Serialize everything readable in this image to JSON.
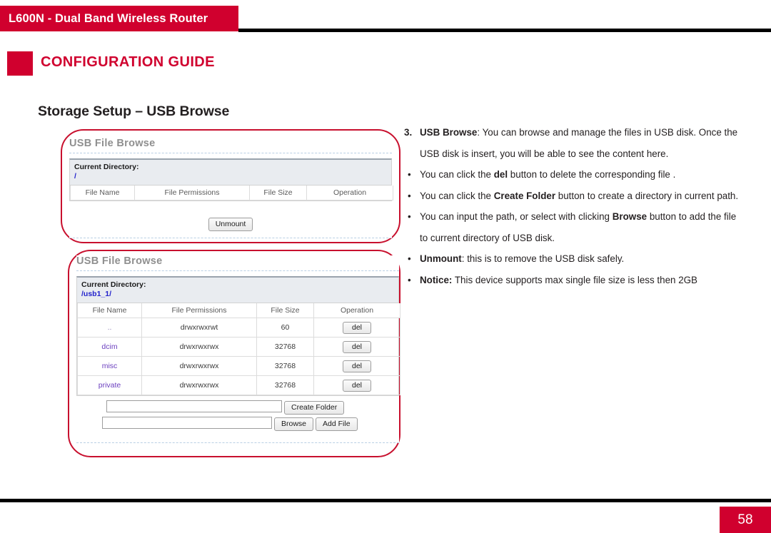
{
  "header": {
    "product_title": "L600N - Dual Band Wireless Router",
    "section_title": "CONFIGURATION GUIDE",
    "accent_color": "#D0002E"
  },
  "page": {
    "subtitle": "Storage Setup – USB Browse",
    "number": "58"
  },
  "screenshot_empty": {
    "panel_title": "USB File Browse",
    "current_directory_label": "Current Directory:",
    "current_directory_path": "/",
    "columns": [
      "File Name",
      "File Permissions",
      "File Size",
      "Operation"
    ],
    "rows": [],
    "unmount_button": "Unmount"
  },
  "screenshot_listing": {
    "panel_title": "USB File Browse",
    "current_directory_label": "Current Directory:",
    "current_directory_path": "/usb1_1/",
    "columns": [
      "File Name",
      "File Permissions",
      "File Size",
      "Operation"
    ],
    "rows": [
      {
        "name": "..",
        "permissions": "drwxrwxrwt",
        "size": "60",
        "operation": "del"
      },
      {
        "name": "dcim",
        "permissions": "drwxrwxrwx",
        "size": "32768",
        "operation": "del"
      },
      {
        "name": "misc",
        "permissions": "drwxrwxrwx",
        "size": "32768",
        "operation": "del"
      },
      {
        "name": "private",
        "permissions": "drwxrwxrwx",
        "size": "32768",
        "operation": "del"
      }
    ],
    "create_folder_input_value": "",
    "create_folder_button": "Create Folder",
    "add_file_input_value": "",
    "browse_button": "Browse",
    "add_file_button": "Add File"
  },
  "notes": [
    {
      "marker": "3.",
      "marker_type": "number",
      "parts": [
        {
          "text": "USB Browse",
          "bold": true
        },
        {
          "text": ": You can browse and manage the files in USB disk. Once the USB disk is insert, you will be able to see the content here.",
          "bold": false
        }
      ]
    },
    {
      "marker": "•",
      "marker_type": "bullet",
      "parts": [
        {
          "text": "You can click the ",
          "bold": false
        },
        {
          "text": "del",
          "bold": true
        },
        {
          "text": " button to delete the corresponding file .",
          "bold": false
        }
      ]
    },
    {
      "marker": "•",
      "marker_type": "bullet",
      "parts": [
        {
          "text": "You can click the ",
          "bold": false
        },
        {
          "text": "Create Folder",
          "bold": true
        },
        {
          "text": " button to create a directory in current path.",
          "bold": false
        }
      ]
    },
    {
      "marker": "•",
      "marker_type": "bullet",
      "parts": [
        {
          "text": "You can input the path, or select with clicking ",
          "bold": false
        },
        {
          "text": "Browse",
          "bold": true
        },
        {
          "text": " button to add the file to current directory of USB disk.",
          "bold": false
        }
      ]
    },
    {
      "marker": "•",
      "marker_type": "bullet",
      "parts": [
        {
          "text": "Unmount",
          "bold": true
        },
        {
          "text": ": this is to remove the USB disk safely.",
          "bold": false
        }
      ]
    },
    {
      "marker": "•",
      "marker_type": "bullet",
      "parts": [
        {
          "text": "Notice:",
          "bold": true
        },
        {
          "text": " This device supports max single file size is less then 2GB",
          "bold": false
        }
      ]
    }
  ]
}
